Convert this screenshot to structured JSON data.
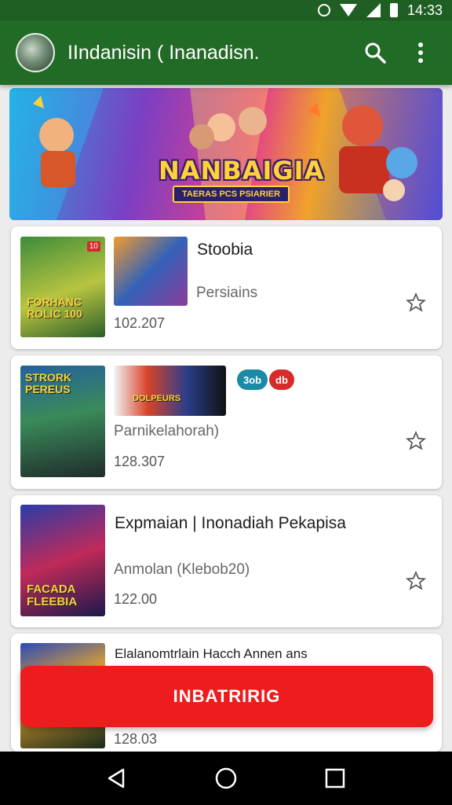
{
  "status_bar": {
    "time": "14:33"
  },
  "app_bar": {
    "title": "IIndanisin ( Inanadisn."
  },
  "banner": {
    "logo_text": "NANBAIGIA",
    "subtitle": "TAERAS PCS PSIARIER"
  },
  "cards": [
    {
      "title": "Stoobia",
      "subtitle": "Persiains",
      "count": "102.207",
      "cover1_text": "FORHANC ROLIC 100",
      "cover1_badge": "10"
    },
    {
      "title": "",
      "subtitle": "Parnikelahorah)",
      "count": "128.307",
      "cover1_text": "STRORK PEREUS",
      "cover2_text": "DOLPEURS",
      "pills": [
        "3ob",
        "db"
      ]
    },
    {
      "title": "Expmaian | Inonadiah Pekapisa",
      "subtitle": "Anmolan (Klebob20)",
      "count": "122.00",
      "cover1_text": "FACADA FLEEBIA"
    },
    {
      "title": "Elalanomtrlain Hacch Annen ans",
      "count": "128.03"
    }
  ],
  "cta": {
    "label": "INBATRIRIG"
  },
  "colors": {
    "app_bar": "#226b27",
    "status_bar": "#1f5f23",
    "cta": "#ee1c1c"
  }
}
